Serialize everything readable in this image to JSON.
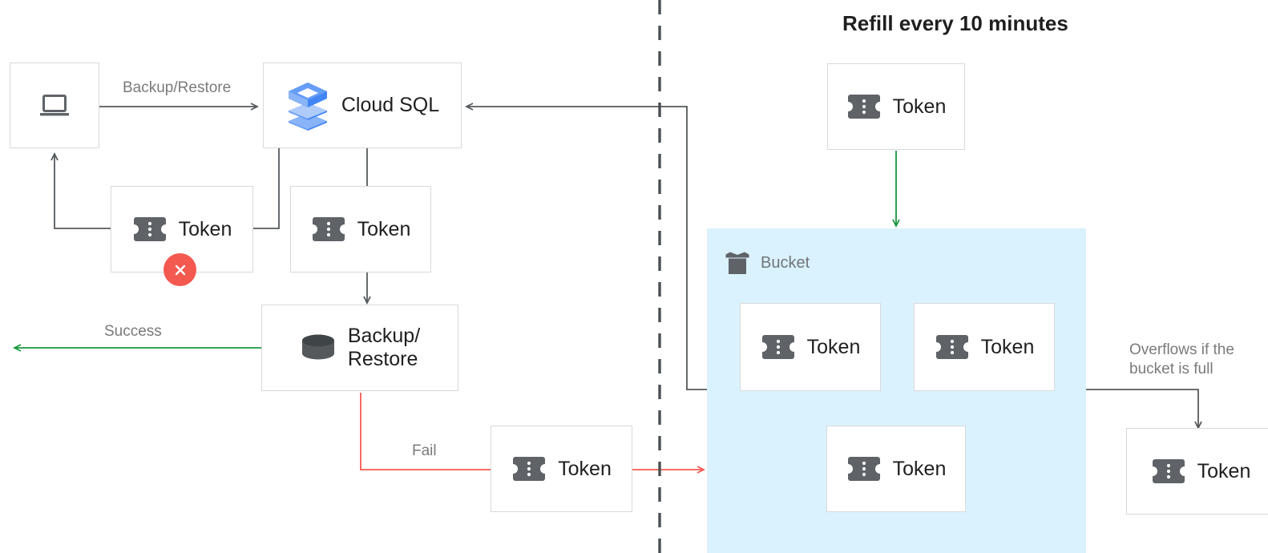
{
  "title": "Refill every 10 minutes",
  "nodes": {
    "client": {
      "icon": "laptop-icon",
      "label": ""
    },
    "cloud_sql": {
      "icon": "cloud-sql-icon",
      "label": "Cloud SQL"
    },
    "token_failed": {
      "icon": "token-icon",
      "label": "Token",
      "badge": "error-x-badge"
    },
    "token_consume": {
      "icon": "token-icon",
      "label": "Token"
    },
    "backup_restore": {
      "icon": "database-icon",
      "label": "Backup/\nRestore"
    },
    "token_fail_return": {
      "icon": "token-icon",
      "label": "Token"
    },
    "token_refill": {
      "icon": "token-icon",
      "label": "Token"
    },
    "bucket_token_1": {
      "icon": "token-icon",
      "label": "Token"
    },
    "bucket_token_2": {
      "icon": "token-icon",
      "label": "Token"
    },
    "bucket_token_3": {
      "icon": "token-icon",
      "label": "Token"
    },
    "token_overflow": {
      "icon": "token-icon",
      "label": "Token"
    }
  },
  "bucket": {
    "icon": "bucket-icon",
    "label": "Bucket"
  },
  "edges": {
    "backup_restore_label": "Backup/Restore",
    "success_label": "Success",
    "fail_label": "Fail",
    "overflow_label": "Overflows if the\nbucket is full"
  },
  "colors": {
    "success_green": "#1a9641",
    "fail_red": "#f4594f",
    "neutral_gray": "#55595c",
    "box_border": "#d9d9d9",
    "bucket_fill": "#daf2fd",
    "token_gray": "#5f6368",
    "label_gray": "#7a7a7a",
    "cloud_sql_blue": "#4285f4",
    "cloud_sql_blue_light": "#aecbfa",
    "divider_gray": "#4a4f52"
  }
}
